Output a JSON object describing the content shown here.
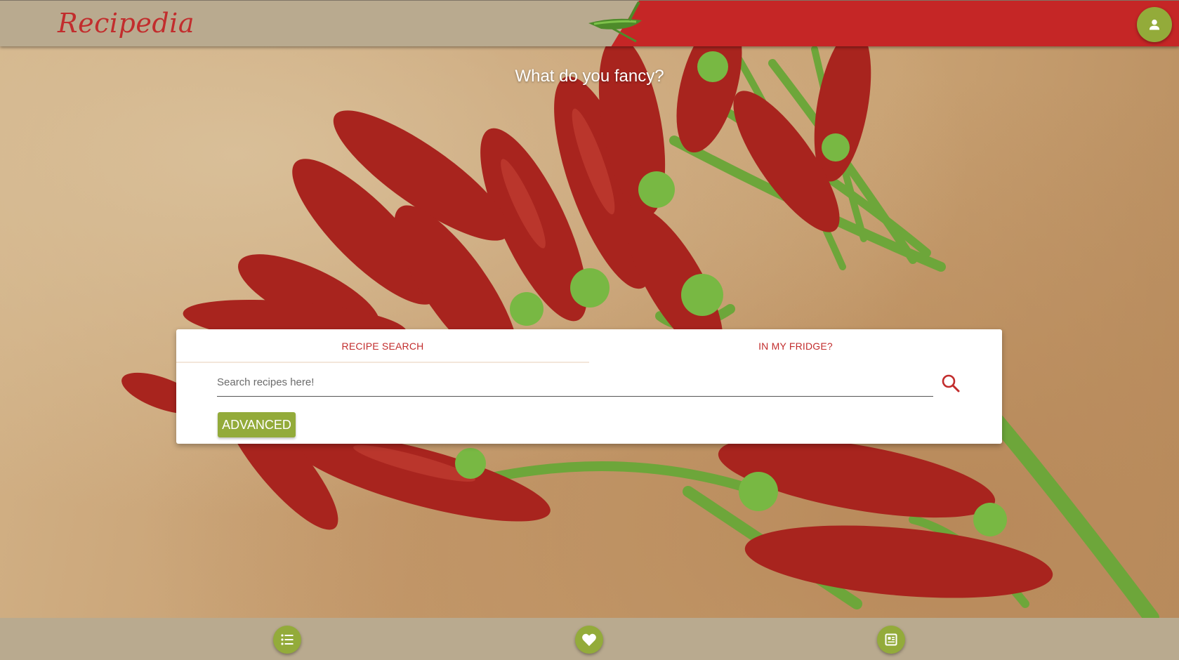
{
  "header": {
    "logo": "Recipedia",
    "profile_icon": "person-icon",
    "decoration_icon": "chili-pepper-icon"
  },
  "hero": {
    "tagline": "What do you fancy?",
    "background_image": "red chili peppers on wooden cutting board"
  },
  "search": {
    "tabs": [
      {
        "label": "RECIPE SEARCH",
        "active": true
      },
      {
        "label": "IN MY FRIDGE?",
        "active": false
      }
    ],
    "placeholder": "Search recipes here!",
    "value": "",
    "search_icon": "search-icon",
    "advanced_label": "ADVANCED"
  },
  "footer": {
    "buttons": [
      {
        "icon": "list-icon"
      },
      {
        "icon": "heart-icon"
      },
      {
        "icon": "news-icon"
      }
    ]
  },
  "colors": {
    "header_bg": "#b9aa8f",
    "header_accent": "#c52626",
    "brand_red": "#c22d2d",
    "accent_green": "#93ab3a",
    "card_bg": "#ffffff"
  }
}
